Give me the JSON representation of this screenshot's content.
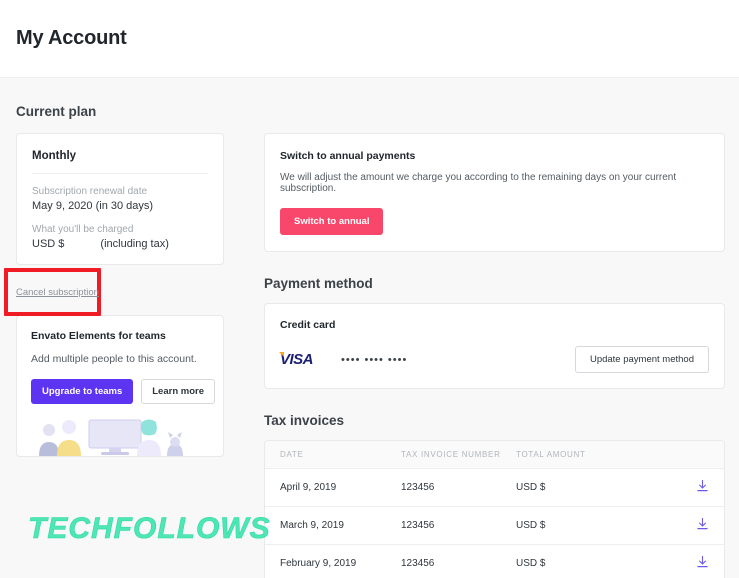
{
  "header": {
    "title": "My Account"
  },
  "current_plan": {
    "section_title": "Current plan",
    "plan_name": "Monthly",
    "renewal_label": "Subscription renewal date",
    "renewal_value": "May 9, 2020 (in 30 days)",
    "charge_label": "What you'll be charged",
    "charge_currency": "USD $",
    "charge_note": "(including tax)",
    "cancel_link": "Cancel subscription"
  },
  "teams": {
    "title": "Envato Elements for teams",
    "description": "Add multiple people to this account.",
    "upgrade_label": "Upgrade to teams",
    "learn_more_label": "Learn more"
  },
  "annual": {
    "title": "Switch to annual payments",
    "description": "We will adjust the amount we charge you according to the remaining days on your current subscription.",
    "button_label": "Switch to annual"
  },
  "payment_method": {
    "section_title": "Payment method",
    "card_label": "Credit card",
    "brand": "VISA",
    "masked_number": "•••• •••• ••••",
    "update_label": "Update payment method"
  },
  "tax_invoices": {
    "section_title": "Tax invoices",
    "columns": [
      "DATE",
      "TAX INVOICE NUMBER",
      "TOTAL AMOUNT",
      ""
    ],
    "rows": [
      {
        "date": "April 9, 2019",
        "number": "123456",
        "amount": "USD $",
        "download": "download-icon"
      },
      {
        "date": "March 9, 2019",
        "number": "123456",
        "amount": "USD $",
        "download": "download-icon"
      },
      {
        "date": "February 9, 2019",
        "number": "123456",
        "amount": "USD $",
        "download": "download-icon"
      }
    ]
  },
  "watermark": {
    "text": "TECHFOLLOWS"
  },
  "colors": {
    "accent_pink": "#f9466b",
    "accent_purple": "#5c34f2",
    "annotation_red": "#ef1c25",
    "download_icon": "#6b59e8",
    "visa_blue": "#1a1f71",
    "visa_gold": "#f7a823",
    "watermark_green": "#4de6b4"
  }
}
